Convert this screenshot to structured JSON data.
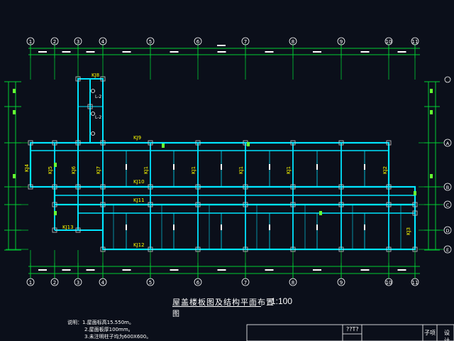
{
  "drawing": {
    "title": "屋盖楼板图及结构平面布置图",
    "title_line1": "屋盖楼板图及结构平面布置",
    "title_line2": "图",
    "scale": "1:100"
  },
  "notes": [
    "说明：1.屋面标高15.550m。",
    "2.屋面板厚100mm。",
    "3.未注明柱子均为600X600。"
  ],
  "axes": {
    "top": [
      "1",
      "2",
      "3",
      "4",
      "5",
      "6",
      "7",
      "8",
      "9",
      "10",
      "11"
    ],
    "bottom": [
      "1",
      "2",
      "3",
      "4",
      "5",
      "6",
      "7",
      "8",
      "9",
      "10",
      "11"
    ],
    "right": [
      "A",
      "B",
      "C",
      "D",
      "E"
    ]
  },
  "frame_labels": {
    "horizontal": [
      "KJ8",
      "KJ9",
      "KJ10",
      "KJ11",
      "KJ12",
      "KJ13"
    ],
    "vertical": [
      "KJ4",
      "KJ5",
      "KJ6",
      "KJ7",
      "KJ1",
      "KJ1",
      "KJ1",
      "KJ1",
      "KJ2",
      "KJ3"
    ],
    "beams": [
      "L-2",
      "L-2"
    ]
  },
  "title_block": {
    "cell1": "??T?",
    "cell2": "子项",
    "cell3": "设计"
  },
  "colors": {
    "background": "#0b0f1a",
    "beam": "#00e5ff",
    "axis": "#00cc33",
    "column": "#cccccc",
    "text": "#ffffff",
    "label": "#ffff00"
  }
}
